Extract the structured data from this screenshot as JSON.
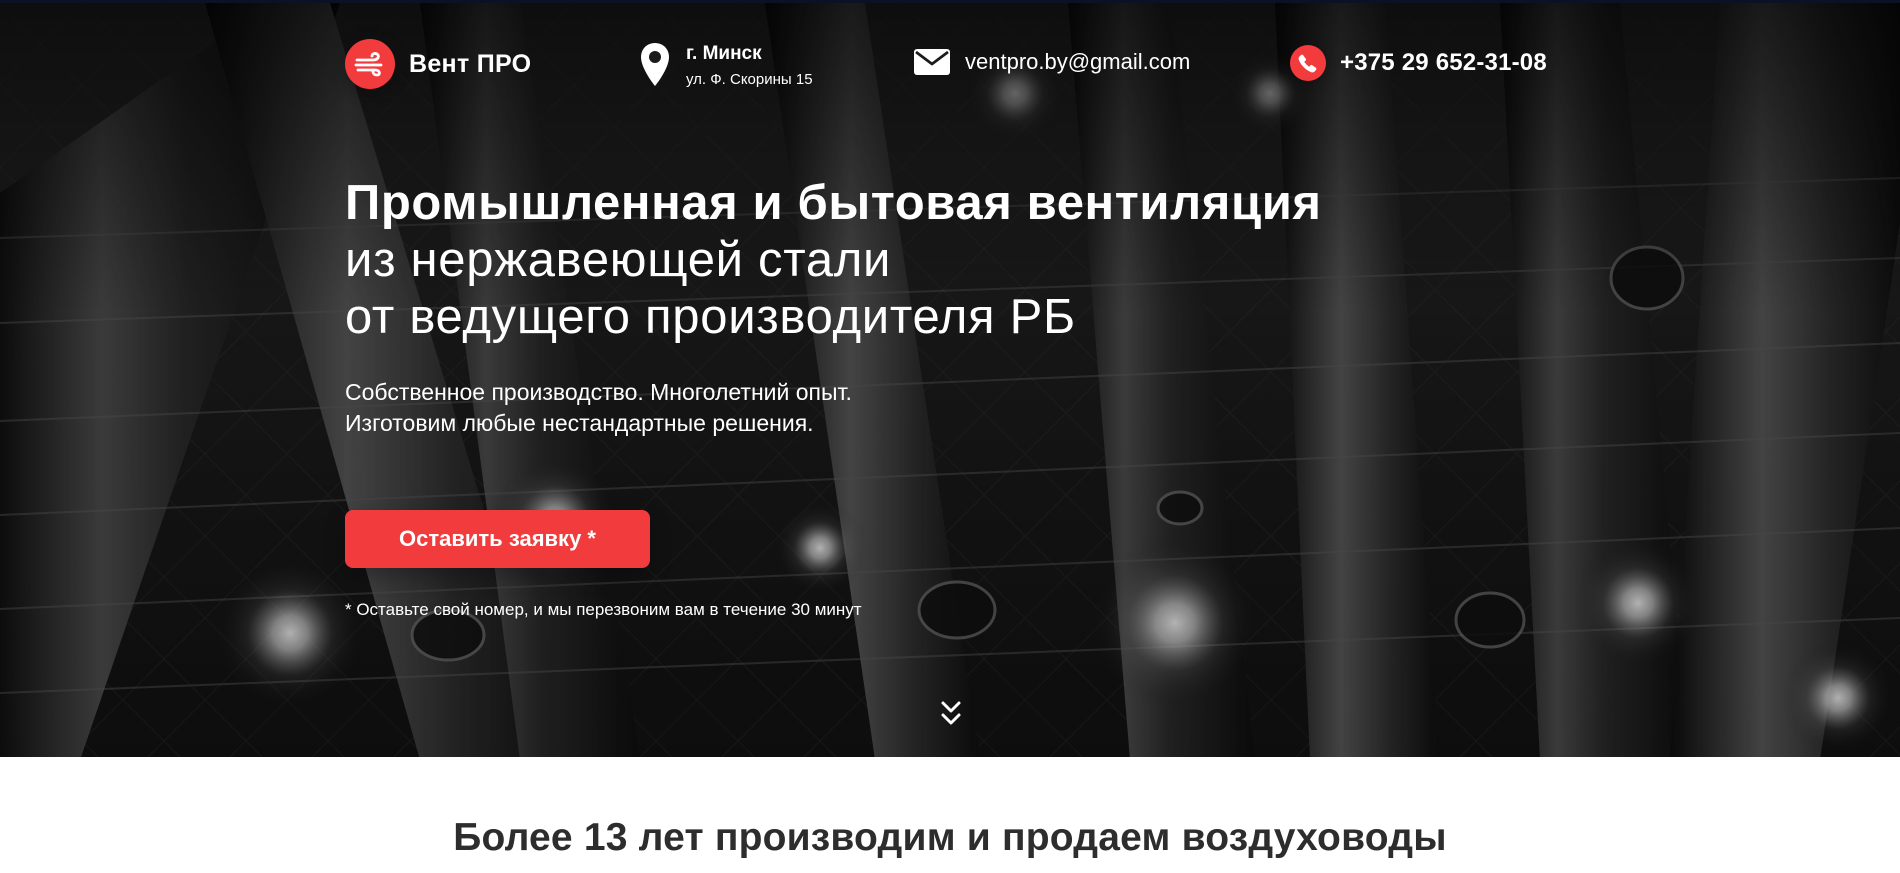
{
  "brand": {
    "name": "Вент ПРО",
    "accent_color": "#f23b3d",
    "icon": "wind-icon"
  },
  "contacts": {
    "city": "г. Минск",
    "street": "ул. Ф. Скорины 15",
    "email": "ventpro.by@gmail.com",
    "phone": "+375 29 652-31-08",
    "location_icon": "location-pin-icon",
    "email_icon": "mail-icon",
    "phone_icon": "phone-icon"
  },
  "hero": {
    "headline_line1": "Промышленная и бытовая вентиляция",
    "headline_line2": "из нержавеющей стали",
    "headline_line3": "от ведущего производителя РБ",
    "subtitle_line1": "Собственное производство. Многолетний опыт.",
    "subtitle_line2": "Изготовим любые нестандартные решения.",
    "cta_label": "Оставить заявку *",
    "cta_note": "* Оставьте свой номер, и мы перезвоним вам в течение 30 минут",
    "scroll_icon": "double-chevron-down-icon"
  },
  "section": {
    "title": "Более 13 лет производим и продаем воздуховоды"
  }
}
